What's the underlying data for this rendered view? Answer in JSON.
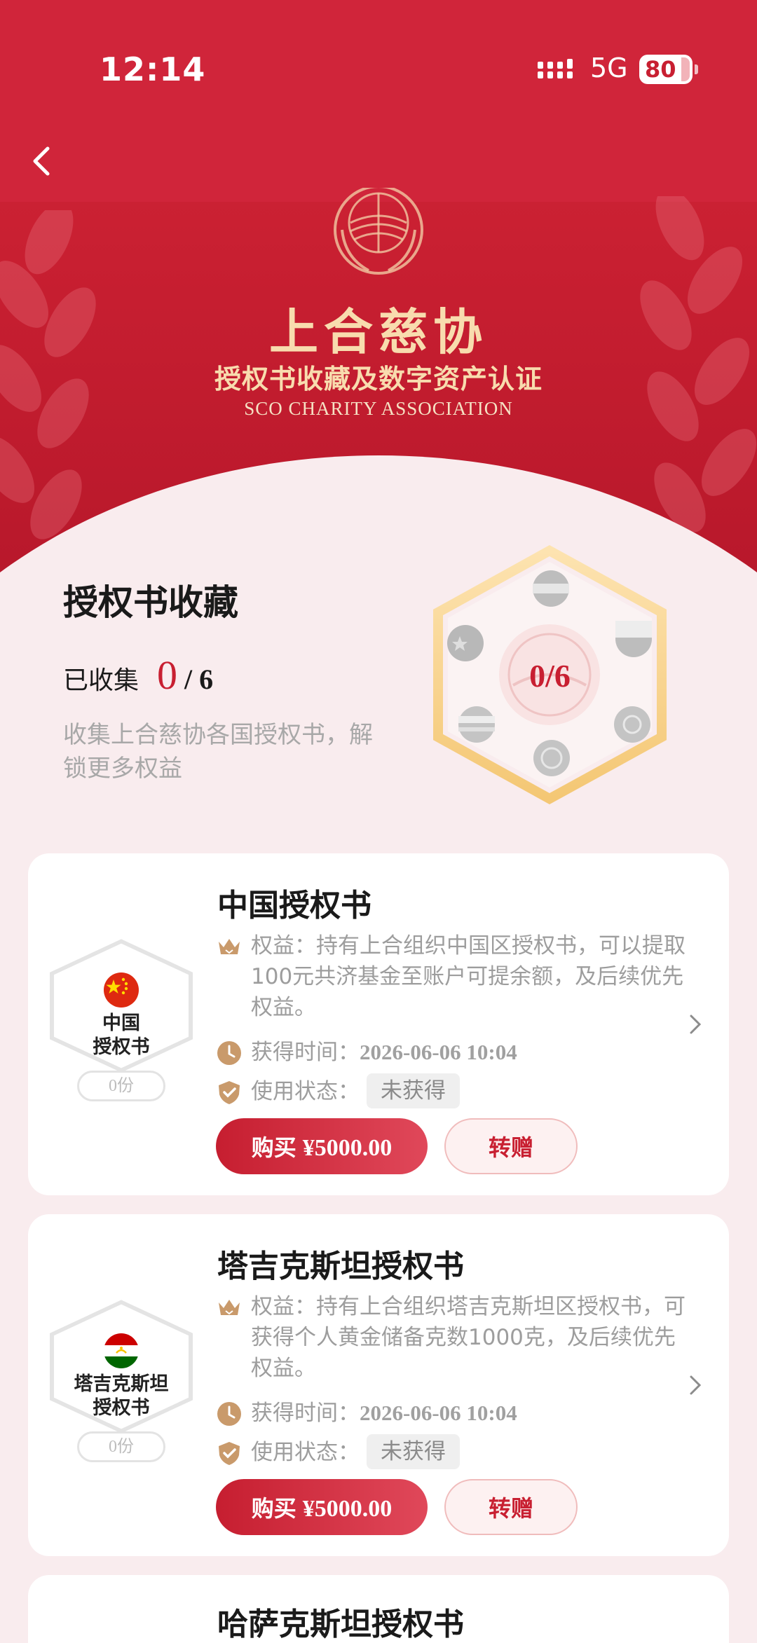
{
  "status_bar": {
    "time": "12:14",
    "network": "5G",
    "battery": "80"
  },
  "header": {
    "title": "上合慈协",
    "subtitle": "授权书收藏及数字资产认证",
    "subtitle_en": "SCO CHARITY ASSOCIATION"
  },
  "collection": {
    "title": "授权书收藏",
    "collected_label": "已收集",
    "collected": "0",
    "total": "/ 6",
    "description": "收集上合慈协各国授权书，解锁更多权益",
    "hex_label": "0/6"
  },
  "cards": [
    {
      "badge_line1": "中国",
      "badge_line2": "授权书",
      "copies": "0份",
      "title": "中国授权书",
      "benefit": "权益：持有上合组织中国区授权书，可以提取100元共济基金至账户可提余额，及后续优先权益。",
      "time_label": "获得时间：",
      "time_value": "2026-06-06 10:04",
      "status_label": "使用状态：",
      "status_value": "未获得",
      "buy_label": "购买",
      "price": "¥5000.00",
      "gift_label": "转赠"
    },
    {
      "badge_line1": "塔吉克斯坦",
      "badge_line2": "授权书",
      "copies": "0份",
      "title": "塔吉克斯坦授权书",
      "benefit": "权益：持有上合组织塔吉克斯坦区授权书，可获得个人黄金储备克数1000克，及后续优先权益。",
      "time_label": "获得时间：",
      "time_value": "2026-06-06 10:04",
      "status_label": "使用状态：",
      "status_value": "未获得",
      "buy_label": "购买",
      "price": "¥5000.00",
      "gift_label": "转赠"
    },
    {
      "title": "哈萨克斯坦授权书"
    }
  ],
  "colors": {
    "brand_red": "#c81f31",
    "gold": "#f8dcae",
    "page_bg": "#f9ecee"
  },
  "icons": [
    "back-icon",
    "crown-icon",
    "clock-icon",
    "shield-check-icon",
    "chevron-right-icon"
  ]
}
